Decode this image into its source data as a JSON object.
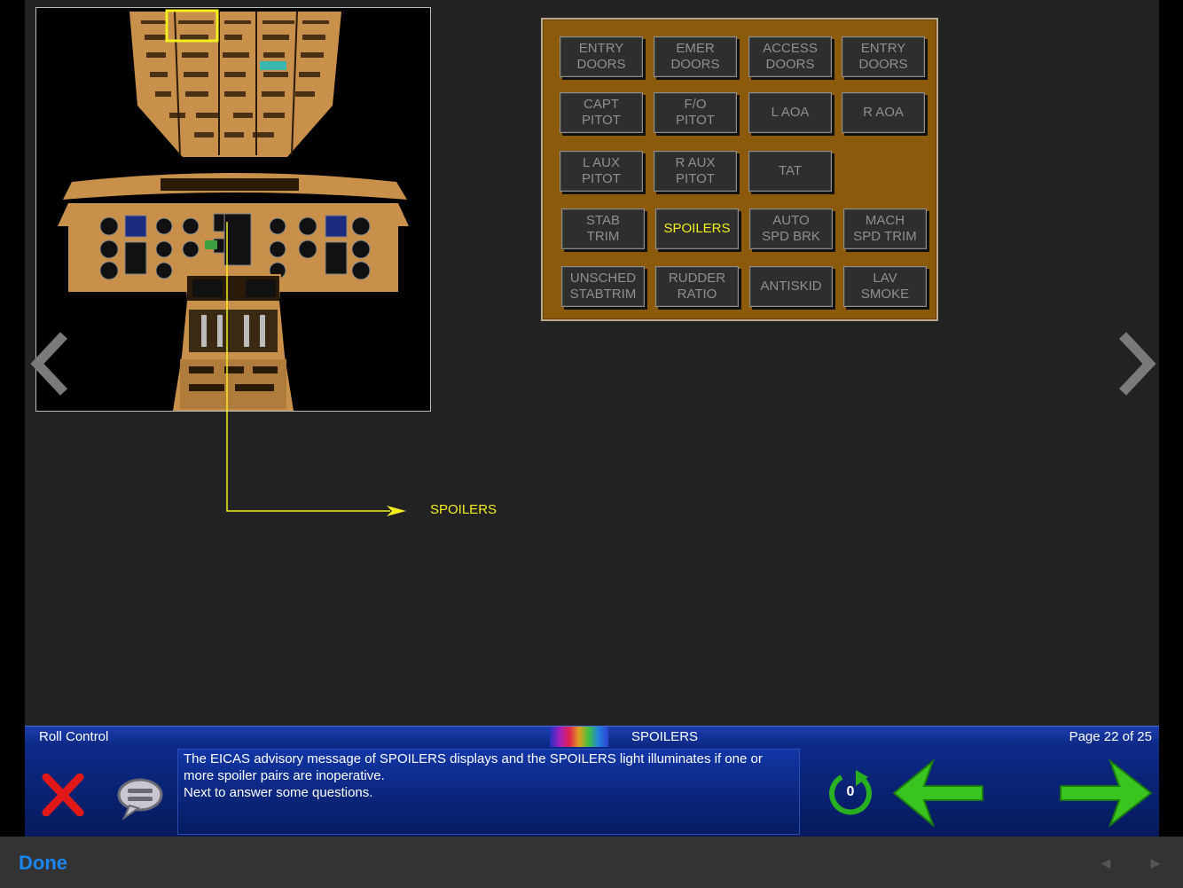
{
  "panel": {
    "buttons": [
      [
        "ENTRY\nDOORS",
        "EMER\nDOORS",
        "ACCESS\nDOORS",
        "ENTRY\nDOORS"
      ],
      [
        "CAPT\nPITOT",
        "F/O\nPITOT",
        "L AOA",
        "R AOA"
      ],
      [
        "L AUX\nPITOT",
        "R AUX\nPITOT",
        "TAT"
      ],
      [
        "STAB\nTRIM",
        "SPOILERS",
        "AUTO\nSPD BRK",
        "MACH\nSPD TRIM"
      ],
      [
        "UNSCHED\nSTABTRIM",
        "RUDDER\nRATIO",
        "ANTISKID",
        "LAV\nSMOKE"
      ]
    ],
    "active": "SPOILERS",
    "colors": {
      "panel": "#8b5a0a",
      "active_text": "#f4ee1e",
      "inactive_text": "#8f8f8f"
    }
  },
  "callout": {
    "label": "SPOILERS"
  },
  "status": {
    "lesson": "Roll Control",
    "topic": "SPOILERS",
    "page": "Page 22 of 25"
  },
  "message": {
    "line1": "The EICAS advisory message of SPOILERS displays and the SPOILERS light illuminates if one or more spoiler pairs are inoperative.",
    "line2": "Next to answer some questions."
  },
  "controls": {
    "replay_count": "0",
    "close_icon": "close-x-icon",
    "comment_icon": "speech-bubble-icon",
    "replay_icon": "replay-icon",
    "prev_icon": "arrow-left-icon",
    "next_icon": "arrow-right-icon"
  },
  "footer": {
    "done_label": "Done",
    "prev_glyph": "◄",
    "next_glyph": "►"
  }
}
